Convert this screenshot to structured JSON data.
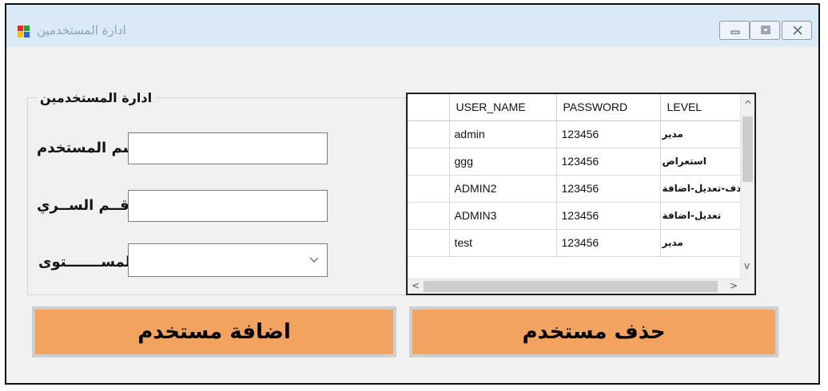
{
  "window": {
    "title": "ادارة المستخدمين"
  },
  "form": {
    "group_title": "ادارة المستخدمين",
    "username_label": "اسم المستخدم",
    "password_label": "الرقــم الســري",
    "level_label": "المســـــــتوى",
    "username_value": "",
    "password_value": "",
    "level_value": ""
  },
  "grid": {
    "columns": [
      "USER_NAME",
      "PASSWORD",
      "LEVEL"
    ],
    "rows": [
      {
        "user": "admin",
        "password": "123456",
        "level": "مدير"
      },
      {
        "user": "ggg",
        "password": "123456",
        "level": "استعراض"
      },
      {
        "user": "ADMIN2",
        "password": "123456",
        "level": "حذف-تعديل-اضافة"
      },
      {
        "user": "ADMIN3",
        "password": "123456",
        "level": "تعديل-اضافة"
      },
      {
        "user": "test",
        "password": "123456",
        "level": "مدير"
      }
    ]
  },
  "buttons": {
    "add_label": "اضافة مستخدم",
    "delete_label": "حذف مستخدم"
  },
  "colors": {
    "button_bg": "#f2a360",
    "titlebar_bg": "#dbe8f5"
  }
}
